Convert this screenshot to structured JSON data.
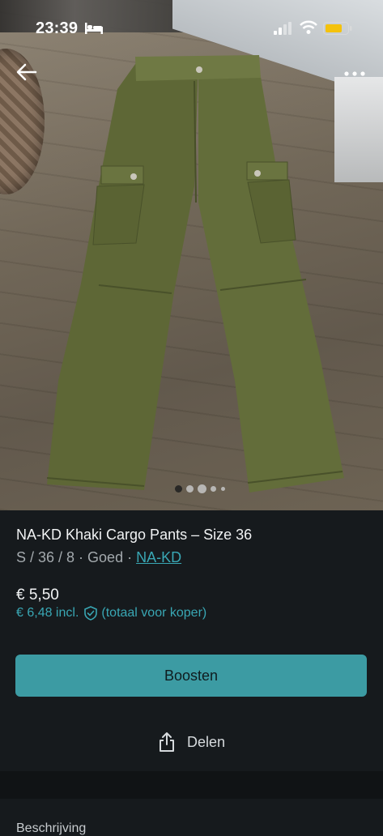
{
  "status_bar": {
    "time": "23:39",
    "icons": [
      "bed-icon",
      "signal-icon",
      "wifi-icon",
      "battery-icon"
    ]
  },
  "nav": {
    "back_icon": "arrow-left-icon",
    "more_icon": "more-horizontal-icon"
  },
  "photo": {
    "pager_dots": 5,
    "active_dot": 1
  },
  "listing": {
    "title": "NA-KD Khaki Cargo Pants – Size 36",
    "meta_prefix": "S / 36 / 8 · Goed · ",
    "brand": "NA-KD",
    "price": "€ 5,50",
    "price_incl": "€ 6,48 incl.",
    "buyer_total": "(totaal voor koper)"
  },
  "actions": {
    "boost_label": "Boosten",
    "share_label": "Delen"
  },
  "section": {
    "description_label": "Beschrijving"
  },
  "colors": {
    "accent": "#3c9ba3",
    "link": "#39a7b4",
    "background": "#161a1d"
  }
}
